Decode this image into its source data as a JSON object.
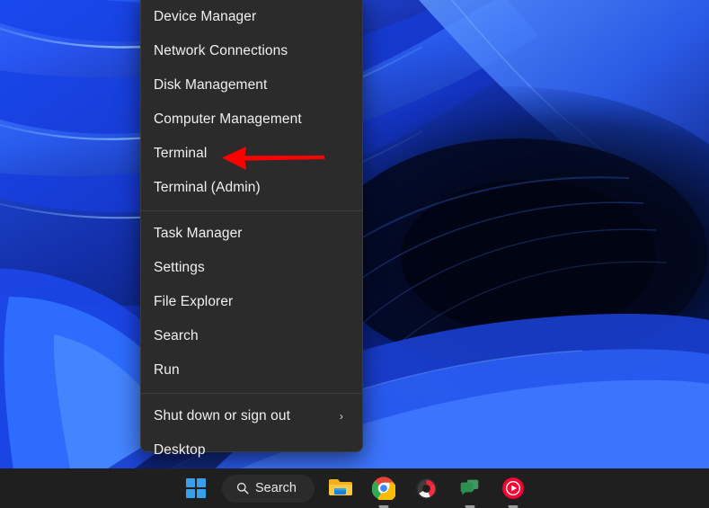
{
  "desktop": {
    "wallpaper_name": "windows-11-bloom-blue",
    "colors": {
      "deep_blue": "#0a1a6e",
      "mid_blue": "#1b3fd8",
      "bright_blue": "#2e6bff",
      "cyan_highlight": "#5ea8ff",
      "dark_vortex": "#030a2a"
    }
  },
  "winx_menu": {
    "name": "Win+X Power User Menu",
    "background_color": "#2b2b2b",
    "text_color": "#f0f0f0",
    "groups": [
      {
        "items": [
          {
            "label": "Device Manager",
            "name": "device-manager",
            "has_submenu": false
          },
          {
            "label": "Network Connections",
            "name": "network-connections",
            "has_submenu": false
          },
          {
            "label": "Disk Management",
            "name": "disk-management",
            "has_submenu": false
          },
          {
            "label": "Computer Management",
            "name": "computer-management",
            "has_submenu": false
          },
          {
            "label": "Terminal",
            "name": "terminal",
            "has_submenu": false
          },
          {
            "label": "Terminal (Admin)",
            "name": "terminal-admin",
            "has_submenu": false
          }
        ]
      },
      {
        "items": [
          {
            "label": "Task Manager",
            "name": "task-manager",
            "has_submenu": false
          },
          {
            "label": "Settings",
            "name": "settings",
            "has_submenu": false
          },
          {
            "label": "File Explorer",
            "name": "file-explorer",
            "has_submenu": false
          },
          {
            "label": "Search",
            "name": "search",
            "has_submenu": false
          },
          {
            "label": "Run",
            "name": "run",
            "has_submenu": false
          }
        ]
      },
      {
        "items": [
          {
            "label": "Shut down or sign out",
            "name": "shut-down-or-sign-out",
            "has_submenu": true,
            "chevron": "›"
          },
          {
            "label": "Desktop",
            "name": "desktop",
            "has_submenu": false
          }
        ]
      }
    ]
  },
  "annotation": {
    "type": "arrow",
    "color": "#ff0000",
    "direction": "left",
    "points_to": "Terminal"
  },
  "taskbar": {
    "background_color": "#1f1f1f",
    "start_button": {
      "name": "start-button",
      "icon": "windows-logo-icon",
      "tile_color": "#3aa0e8"
    },
    "search": {
      "name": "search-box",
      "icon": "search-icon",
      "label": "Search",
      "background_color": "#2b2b2b"
    },
    "apps": [
      {
        "name": "file-explorer",
        "icon": "folder-icon",
        "label": "File Explorer",
        "running": false,
        "color": "#ffb900"
      },
      {
        "name": "google-chrome",
        "icon": "chrome-icon",
        "label": "Google Chrome",
        "running": true,
        "color": "#4285f4"
      },
      {
        "name": "opera-gx",
        "icon": "opera-gx-icon",
        "label": "Opera GX",
        "running": false,
        "color": "#ff1b2d"
      },
      {
        "name": "chat",
        "icon": "chat-bubbles-icon",
        "label": "Chat",
        "running": true,
        "color": "#2f9e5b"
      },
      {
        "name": "youtube-music",
        "icon": "youtube-music-icon",
        "label": "YouTube Music",
        "running": true,
        "color": "#ff0033"
      }
    ]
  }
}
